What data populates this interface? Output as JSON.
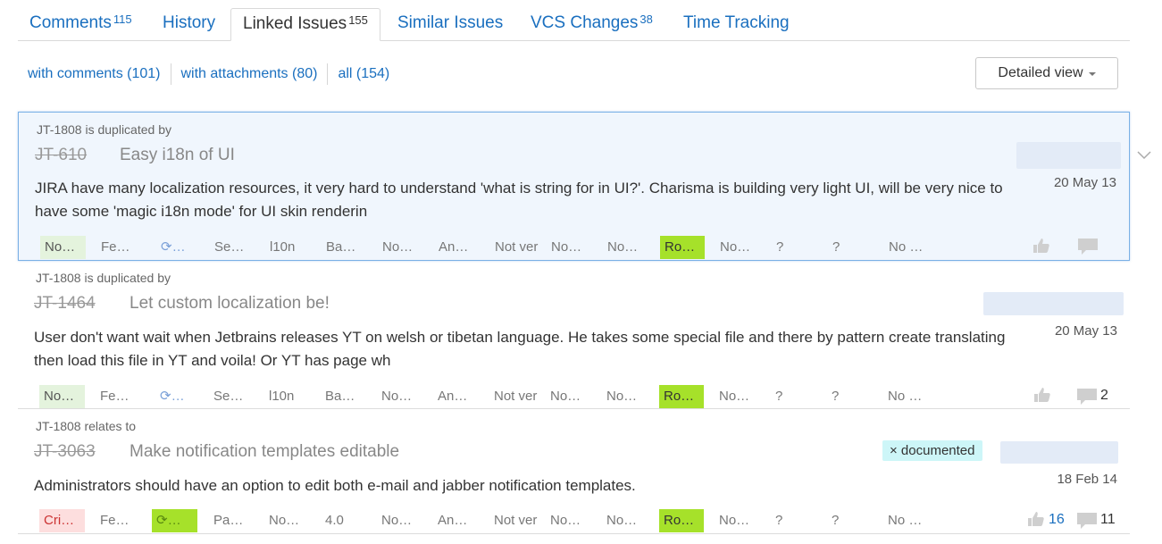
{
  "tabs": [
    {
      "label": "Comments",
      "count": "115"
    },
    {
      "label": "History",
      "count": ""
    },
    {
      "label": "Linked Issues",
      "count": "155"
    },
    {
      "label": "Similar Issues",
      "count": ""
    },
    {
      "label": "VCS Changes",
      "count": "38"
    },
    {
      "label": "Time Tracking",
      "count": ""
    }
  ],
  "filters": [
    "with comments (101)",
    "with attachments (80)",
    "all (154)"
  ],
  "view_button": "Detailed view",
  "issues": [
    {
      "relation": "JT-1808 is duplicated by",
      "id": "JT-610",
      "summary": "Easy i18n of UI",
      "description": "JIRA have many localization resources, it very hard to understand 'what is string for in UI?'. Charisma is building very light UI, will be very nice to have some 'magic i18n mode' for UI skin renderin",
      "date": "20 May 13",
      "fields": [
        "No…",
        "Fe…",
        "⟳…",
        "Se…",
        "l10n",
        "Ba…",
        "No…",
        "An…",
        "Not ver",
        "No…",
        "No…",
        "Ro…",
        "No…",
        "?",
        "?",
        "No …"
      ],
      "votes": "",
      "comments": ""
    },
    {
      "relation": "JT-1808 is duplicated by",
      "id": "JT-1464",
      "summary": "Let custom localization be!",
      "description": "User don't want wait when Jetbrains releases YT on welsh or tibetan language. He takes some special file and there by pattern create translating then load this file in YT and voila! Or YT has page wh",
      "date": "20 May 13",
      "fields": [
        "No…",
        "Fe…",
        "⟳…",
        "Se…",
        "l10n",
        "Ba…",
        "No…",
        "An…",
        "Not ver",
        "No…",
        "No…",
        "Ro…",
        "No…",
        "?",
        "?",
        "No …"
      ],
      "votes": "",
      "comments": "2"
    },
    {
      "relation": "JT-1808 relates to",
      "id": "JT-3063",
      "summary": "Make notification templates editable",
      "tag": "× documented",
      "description": "Administrators should have an option to edit both e-mail and jabber notification templates.",
      "date": "18 Feb 14",
      "fields": [
        "Cri…",
        "Fe…",
        "⟳…",
        "Pa…",
        "No…",
        "4.0",
        "No…",
        "An…",
        "Not ver",
        "No…",
        "No…",
        "Ro…",
        "No…",
        "?",
        "?",
        "No …"
      ],
      "votes": "16",
      "comments": "11"
    }
  ],
  "colors": {
    "link": "#1a6fbf",
    "selected_bg": "#f0f6fd",
    "green_field": "#e4f3dd",
    "lime_field": "#a6e12a",
    "critical_field": "#fddede",
    "tag_bg": "#cdf6f8"
  },
  "icons": [
    "thumbs-up-icon",
    "comment-icon",
    "chevron-down-icon",
    "caret-down-icon"
  ]
}
